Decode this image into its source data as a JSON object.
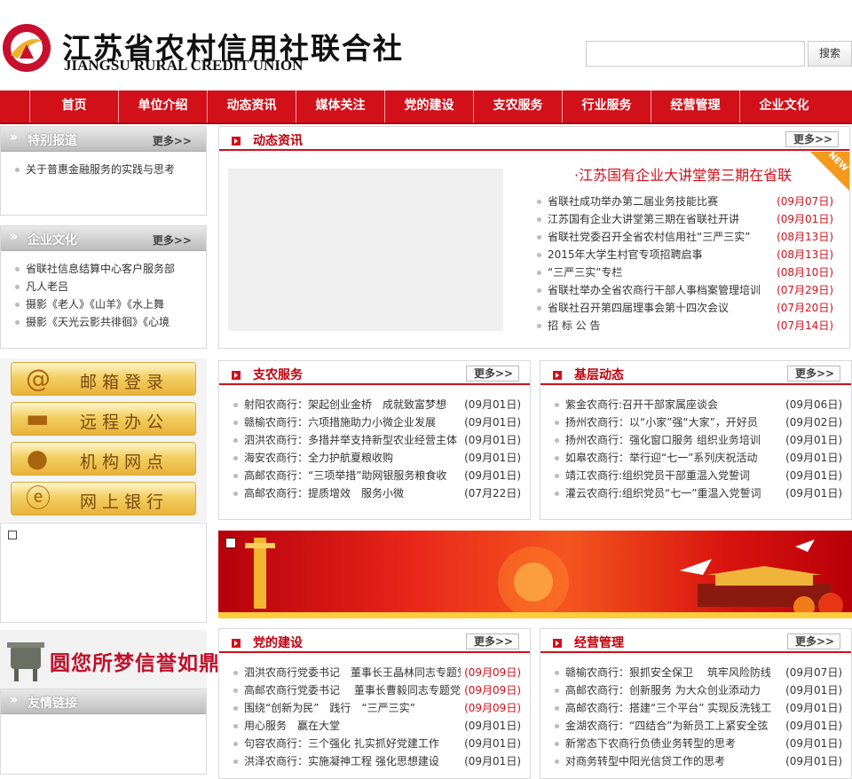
{
  "header": {
    "logo_cn": "江苏省农村信用社联合社",
    "logo_en": "JIANGSU RURAL CREDIT UNION",
    "search_placeholder": "",
    "search_button": "搜索"
  },
  "nav": [
    "首页",
    "单位介绍",
    "动态资讯",
    "媒体关注",
    "党的建设",
    "支农服务",
    "行业服务",
    "经营管理",
    "企业文化"
  ],
  "special": {
    "title": "特别报道",
    "more": "更多>>",
    "items": [
      "关于普惠金融服务的实践与思考"
    ]
  },
  "culture": {
    "title": "企业文化",
    "more": "更多>>",
    "items": [
      "省联社信息结算中心客户服务部",
      "凡人老吕",
      "摄影《老人》《山羊》《水上舞",
      "摄影《天光云影共徘徊》《心境"
    ]
  },
  "news": {
    "title": "动态资讯",
    "more": "更多>>",
    "headline": "·江苏国有企业大讲堂第三期在省联",
    "badge": "NEW",
    "items": [
      {
        "text": "省联社成功举办第二届业务技能比赛",
        "date": "(09月07日)"
      },
      {
        "text": "江苏国有企业大讲堂第三期在省联社开讲",
        "date": "(09月01日)"
      },
      {
        "text": "省联社党委召开全省农村信用社“三严三实”",
        "date": "(08月13日)"
      },
      {
        "text": "2015年大学生村官专项招聘启事",
        "date": "(08月13日)"
      },
      {
        "text": "“三严三实”专栏",
        "date": "(08月10日)"
      },
      {
        "text": "省联社举办全省农商行干部人事档案管理培训",
        "date": "(07月29日)"
      },
      {
        "text": "省联社召开第四届理事会第十四次会议",
        "date": "(07月20日)"
      },
      {
        "text": "招 标 公 告",
        "date": "(07月14日)"
      }
    ]
  },
  "quick": [
    "邮箱登录",
    "远程办公",
    "机构网点",
    "网上银行"
  ],
  "quick_icons": [
    "at-icon",
    "briefcase-icon",
    "map-pin-icon",
    "e-bank-icon"
  ],
  "agri": {
    "title": "支农服务",
    "more": "更多>>",
    "items": [
      {
        "text": "射阳农商行：架起创业金桥　成就致富梦想",
        "date": "(09月01日)"
      },
      {
        "text": "赣榆农商行：六项措施助力小微企业发展",
        "date": "(09月01日)"
      },
      {
        "text": "泗洪农商行：多措并举支持新型农业经营主体",
        "date": "(09月01日)"
      },
      {
        "text": "海安农商行：全力护航夏粮收购",
        "date": "(09月01日)"
      },
      {
        "text": "高邮农商行：“三项举措”助网银服务粮食收",
        "date": "(09月01日)"
      },
      {
        "text": "高邮农商行：提质增效　服务小微",
        "date": "(07月22日)"
      }
    ]
  },
  "grassroots": {
    "title": "基层动态",
    "more": "更多>>",
    "items": [
      {
        "text": "紫金农商行:召开干部家属座谈会",
        "date": "(09月06日)"
      },
      {
        "text": "扬州农商行：以“小家”强“大家”，开好员",
        "date": "(09月02日)"
      },
      {
        "text": "扬州农商行：强化窗口服务  组织业务培训",
        "date": "(09月01日)"
      },
      {
        "text": "如皋农商行：举行迎“七一”系列庆祝活动",
        "date": "(09月01日)"
      },
      {
        "text": "靖江农商行:组织党员干部重温入党誓词",
        "date": "(09月01日)"
      },
      {
        "text": "灌云农商行:组织党员“七一”重温入党誓词",
        "date": "(09月01日)"
      }
    ]
  },
  "promo_cn": "圆您所梦信誉如鼎",
  "links_title": "友情链接",
  "party": {
    "title": "党的建设",
    "more": "更多>>",
    "items": [
      {
        "text": "泗洪农商行党委书记　董事长王晶林同志专题党",
        "date": "(09月09日)",
        "red": true
      },
      {
        "text": "高邮农商行党委书记　 董事长曹毅同志专题党",
        "date": "(09月09日)",
        "red": true
      },
      {
        "text": "围绕“创新为民”　践行　“三严三实”",
        "date": "(09月09日)",
        "red": true
      },
      {
        "text": "用心服务　赢在大堂",
        "date": "(09月01日)",
        "red": false
      },
      {
        "text": "句容农商行：三个强化  扎实抓好党建工作",
        "date": "(09月01日)",
        "red": false
      },
      {
        "text": "洪泽农商行：实施凝神工程  强化思想建设",
        "date": "(09月01日)",
        "red": false
      }
    ]
  },
  "mgmt": {
    "title": "经营管理",
    "more": "更多>>",
    "items": [
      {
        "text": "赣榆农商行：狠抓安全保卫　 筑牢风险防线",
        "date": "(09月07日)"
      },
      {
        "text": "高邮农商行：创新服务  为大众创业添动力",
        "date": "(09月01日)"
      },
      {
        "text": "高邮农商行：搭建“三个平台”  实现反洗钱工",
        "date": "(09月01日)"
      },
      {
        "text": "金湖农商行：“四结合”为新员工上紧安全弦",
        "date": "(09月01日)"
      },
      {
        "text": "新常态下农商行负债业务转型的思考",
        "date": "(09月01日)"
      },
      {
        "text": "对商务转型中阳光信贷工作的思考",
        "date": "(09月01日)"
      }
    ]
  },
  "colors": {
    "brand_red": "#d2101a",
    "gold": "#f3cf62"
  }
}
